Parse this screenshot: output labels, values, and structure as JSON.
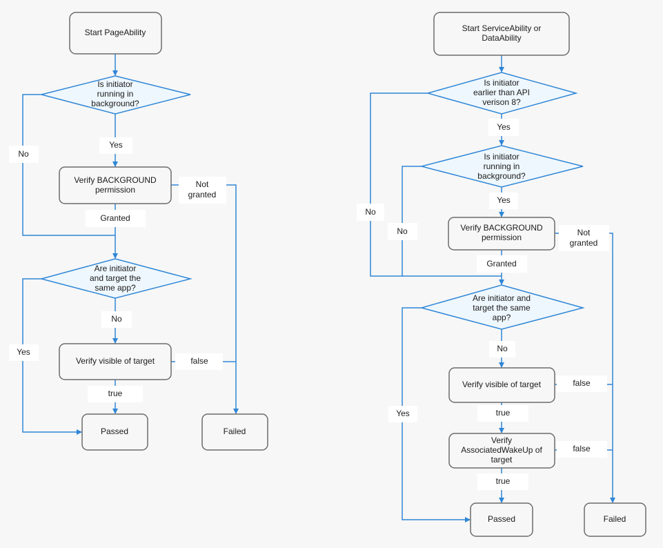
{
  "colors": {
    "line": "#2f86d6",
    "decision_fill": "#eef7fd",
    "box_stroke": "#6b6b6b",
    "background": "#f7f7f7"
  },
  "left": {
    "start": "Start PageAbility",
    "q_background": [
      "Is initiator",
      "running in",
      "background?"
    ],
    "verify_background": [
      "Verify BACKGROUND",
      "permission"
    ],
    "q_same_app": [
      "Are initiator",
      "and target the",
      "same app?"
    ],
    "verify_visible": "Verify visible of target",
    "passed": "Passed",
    "failed": "Failed",
    "labels": {
      "yes1": "Yes",
      "no1": "No",
      "not_granted": [
        "Not",
        "granted"
      ],
      "granted": "Granted",
      "no2": "No",
      "yes2": "Yes",
      "false1": "false",
      "true1": "true"
    }
  },
  "right": {
    "start": [
      "Start ServiceAbility or",
      "DataAbility"
    ],
    "q_api": [
      "Is initiator",
      "earlier than API",
      "verison 8?"
    ],
    "q_background": [
      "Is initiator",
      "running in",
      "background?"
    ],
    "verify_background": [
      "Verify BACKGROUND",
      "permission"
    ],
    "q_same_app": [
      "Are initiator and",
      "target the same",
      "app?"
    ],
    "verify_visible": "Verify visible of target",
    "verify_wakeup": [
      "Verify",
      "AssociatedWakeUp of",
      "target"
    ],
    "passed": "Passed",
    "failed": "Failed",
    "labels": {
      "yes1": "Yes",
      "no1": "No",
      "yes2": "Yes",
      "no2": "No",
      "not_granted": [
        "Not",
        "granted"
      ],
      "granted": "Granted",
      "no3": "No",
      "yes3": "Yes",
      "false1": "false",
      "true1": "true",
      "false2": "false",
      "true2": "true"
    }
  }
}
